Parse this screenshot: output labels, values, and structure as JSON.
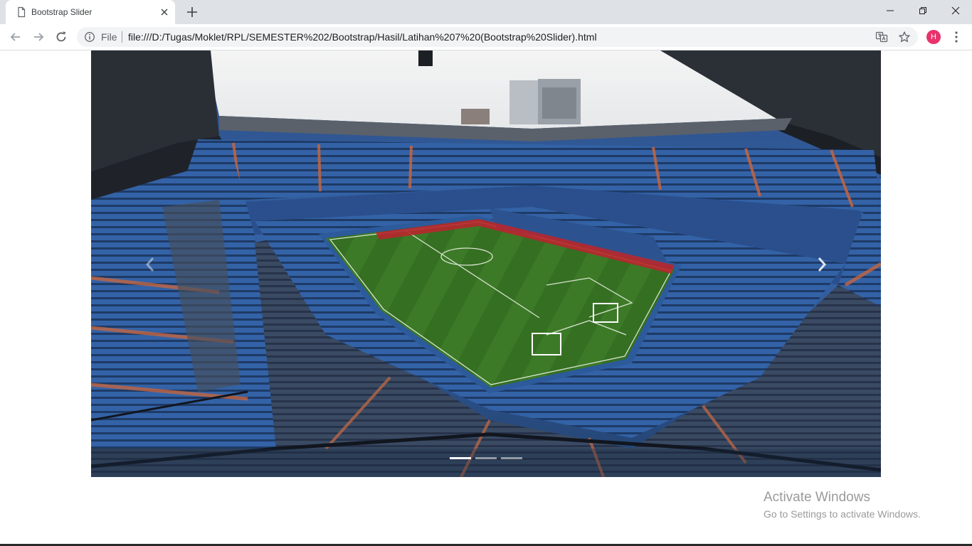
{
  "browser": {
    "tab": {
      "title": "Bootstrap Slider",
      "favicon": "page-icon"
    },
    "window_controls": [
      "minimize-icon",
      "restore-icon",
      "close-icon"
    ],
    "toolbar": {
      "back": "back-arrow-icon",
      "forward": "forward-arrow-icon",
      "reload": "reload-icon",
      "omnibox": {
        "scheme_label": "File",
        "url": "file:///D:/Tugas/Moklet/RPL/SEMESTER%202/Bootstrap/Hasil/Latihan%207%20(Bootstrap%20Slider).html"
      },
      "profile_initial": "H",
      "profile_color": "#e8336d"
    }
  },
  "page": {
    "carousel": {
      "slides": [
        {
          "subject": "stadium-photo",
          "active": true
        },
        {
          "active": false
        },
        {
          "active": false
        }
      ],
      "active_index": 0,
      "prev_icon": "chevron-left-icon",
      "next_icon": "chevron-right-icon"
    }
  },
  "os_overlay": {
    "activate_title": "Activate Windows",
    "activate_subtitle": "Go to Settings to activate Windows."
  },
  "colors": {
    "tabstrip_bg": "#dee1e6",
    "omnibox_bg": "#f1f3f4",
    "seat_blue": "#2f5fa6",
    "pitch_green": "#3d7a28"
  }
}
